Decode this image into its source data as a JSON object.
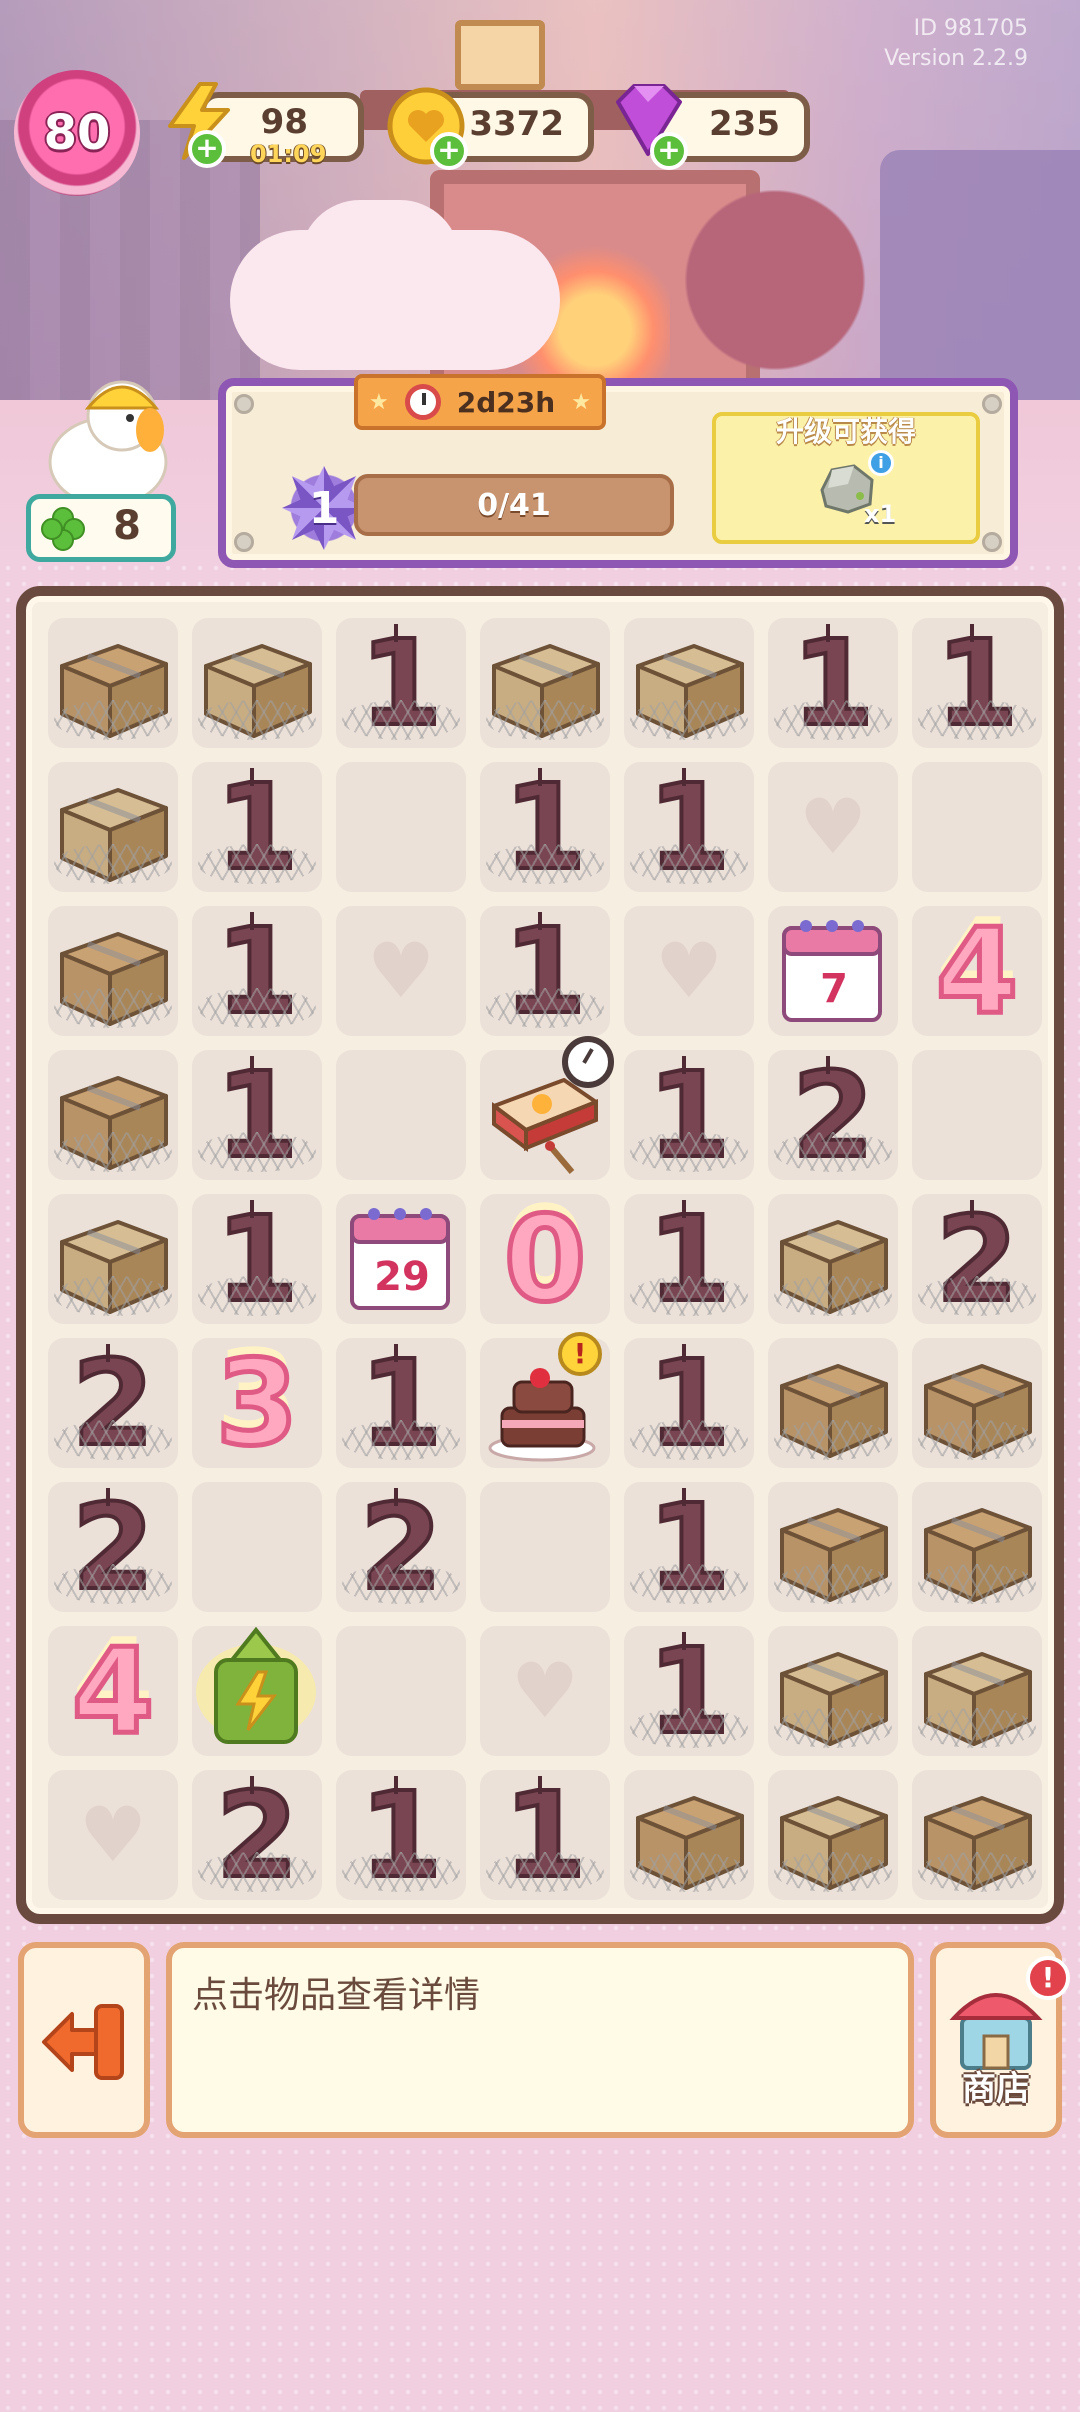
{
  "version": {
    "id": "ID 981705",
    "label": "Version 2.2.9"
  },
  "hud": {
    "level": "80",
    "energy": {
      "value": "98",
      "timer": "01:09",
      "icon": "lightning-icon"
    },
    "coins": {
      "value": "3372",
      "icon": "coin-heart-icon"
    },
    "gems": {
      "value": "235",
      "icon": "purple-gem-icon"
    }
  },
  "event": {
    "clover_count": "8",
    "timer": "2d23h",
    "level": "1",
    "progress_text": "0/41",
    "progress_fraction": 0,
    "reward_title": "升级可获得",
    "reward_qty": "x1",
    "reward_icon": "rock-icon"
  },
  "board": {
    "rows": [
      [
        "box-lg",
        "box",
        "choc-1",
        "box",
        "box",
        "choc-1",
        "choc-1"
      ],
      [
        "box",
        "choc-1",
        "empty",
        "choc-1",
        "choc-1",
        "heart",
        "empty"
      ],
      [
        "box-lg",
        "choc-1",
        "heart",
        "choc-1",
        "heart",
        "calendar-7",
        "pink-4"
      ],
      [
        "box-lg",
        "choc-1",
        "empty",
        "matchbox",
        "choc-1",
        "choc-2",
        "empty"
      ],
      [
        "box",
        "choc-1",
        "calendar-29",
        "pink-0",
        "choc-1",
        "box",
        "choc-2"
      ],
      [
        "choc-2",
        "pink-3",
        "choc-1",
        "cake",
        "choc-1",
        "box-lg",
        "box-lg"
      ],
      [
        "choc-2",
        "empty",
        "choc-2",
        "empty",
        "choc-1",
        "box-lg",
        "box-lg"
      ],
      [
        "pink-4",
        "lantern",
        "empty",
        "heart",
        "choc-1",
        "box",
        "box"
      ],
      [
        "heart",
        "choc-2",
        "choc-1",
        "choc-1",
        "box-lg",
        "box",
        "box-lg"
      ]
    ]
  },
  "bottom": {
    "info_text": "点击物品查看详情",
    "shop_label": "商店",
    "shop_alert": "!"
  }
}
